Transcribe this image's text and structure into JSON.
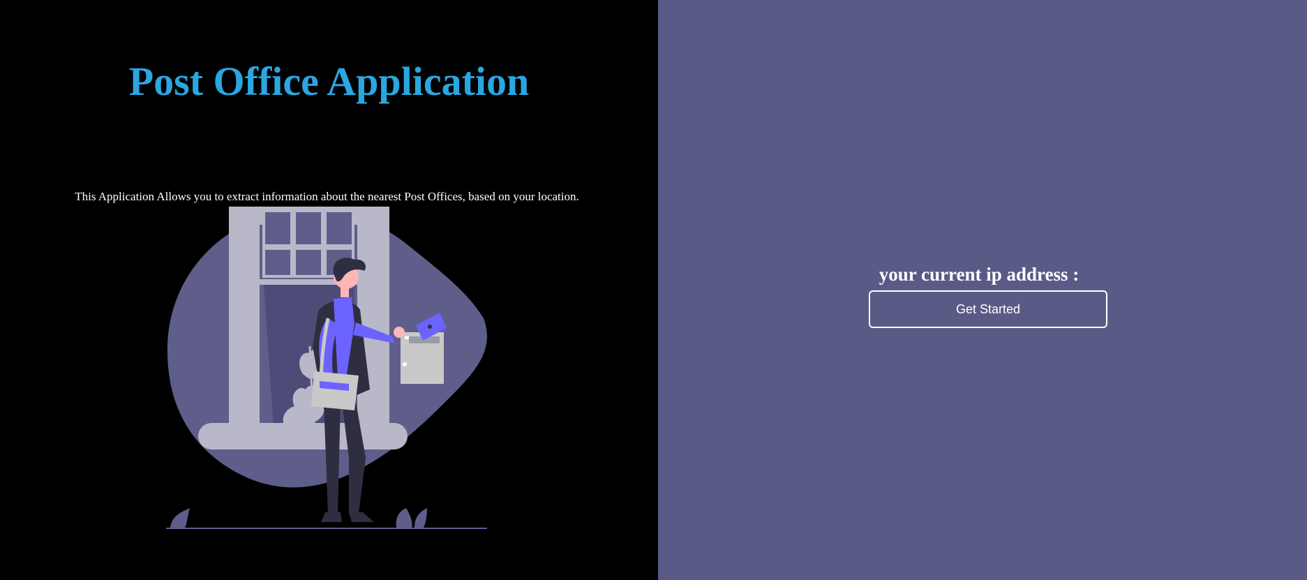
{
  "left": {
    "title": "Post Office Application",
    "description": "This Application Allows you to extract information about the nearest Post Offices, based on your location.",
    "illustration_icon": "person-mailbox-illustration"
  },
  "right": {
    "ip_label": "your current ip address :",
    "get_started_label": "Get Started"
  },
  "colors": {
    "left_background": "#000000",
    "right_background": "#5a5a87",
    "title": "#2aa6e0",
    "text": "#ffffff",
    "accent_purple": "#6c63ff"
  }
}
